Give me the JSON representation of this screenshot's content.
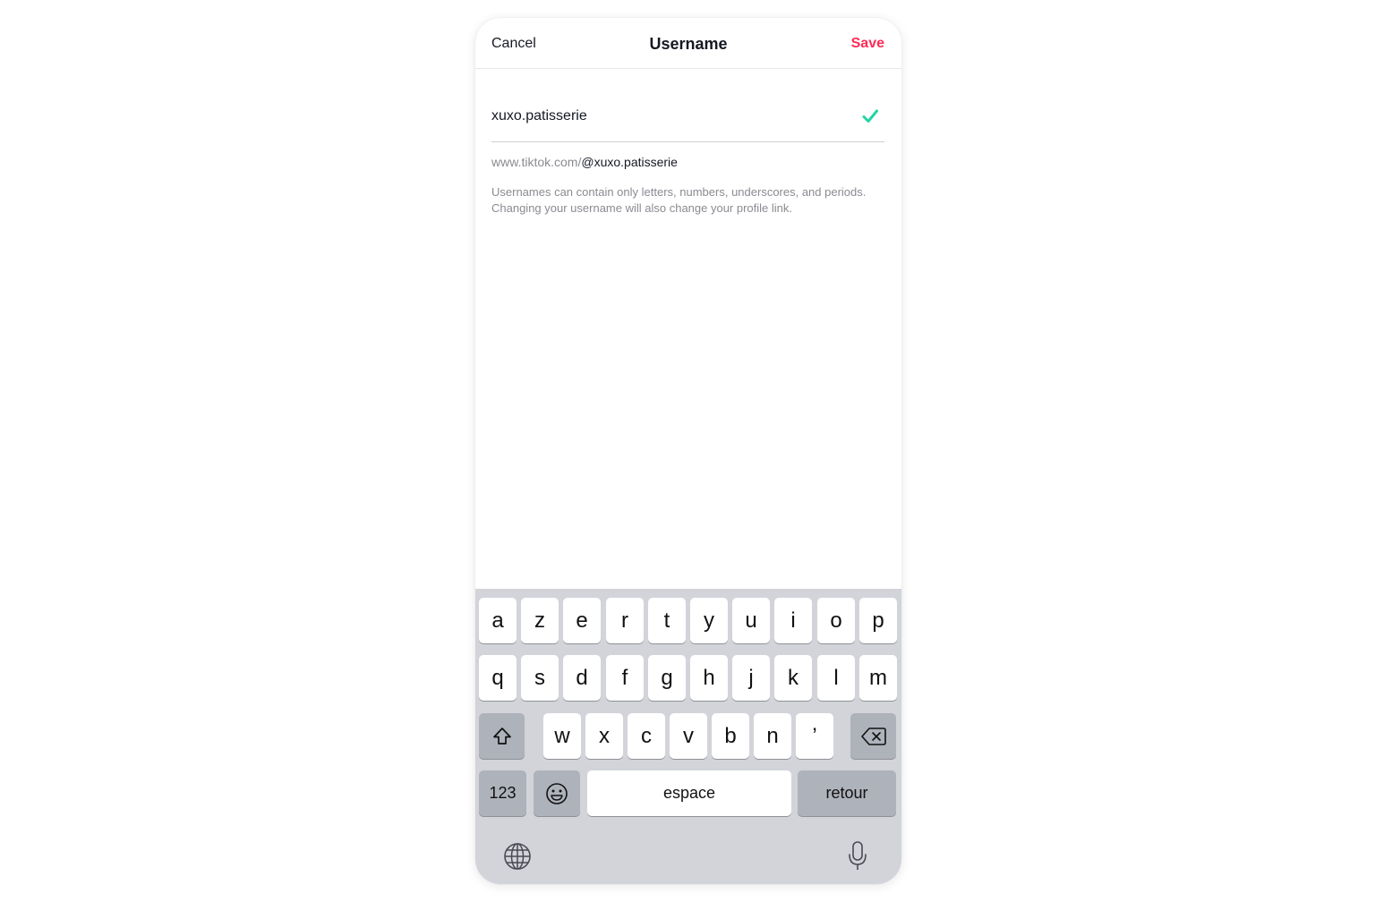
{
  "header": {
    "cancel_label": "Cancel",
    "title": "Username",
    "save_label": "Save"
  },
  "colors": {
    "accent": "#fe2c55",
    "check": "#20d5a4",
    "text": "#161823",
    "muted": "#8a8b91",
    "keyboard_bg": "#d2d4da"
  },
  "form": {
    "username_value": "xuxo.patisserie",
    "valid_icon": "checkmark-icon",
    "profile_link_prefix": "www.tiktok.com/",
    "profile_link_handle": "@xuxo.patisserie",
    "help_text": "Usernames can contain only letters, numbers, underscores, and periods. Changing your username will also change your profile link."
  },
  "keyboard": {
    "row1": [
      "a",
      "z",
      "e",
      "r",
      "t",
      "y",
      "u",
      "i",
      "o",
      "p"
    ],
    "row2": [
      "q",
      "s",
      "d",
      "f",
      "g",
      "h",
      "j",
      "k",
      "l",
      "m"
    ],
    "row3": [
      "w",
      "x",
      "c",
      "v",
      "b",
      "n",
      "’"
    ],
    "numbers_label": "123",
    "space_label": "espace",
    "return_label": "retour",
    "icons": [
      "shift-icon",
      "backspace-icon",
      "emoji-icon",
      "globe-icon",
      "microphone-icon"
    ]
  }
}
